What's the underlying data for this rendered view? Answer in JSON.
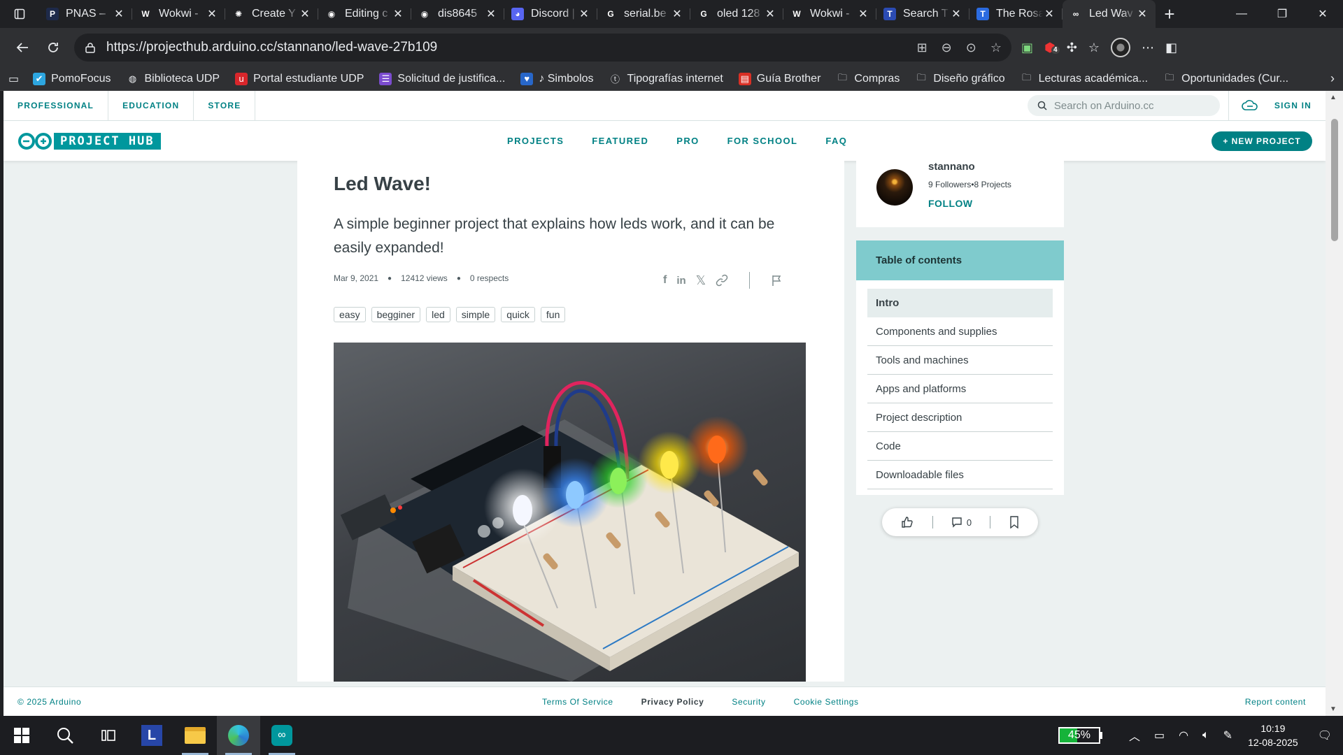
{
  "browser": {
    "tabs": [
      {
        "title": "PNAS – ",
        "fav_color": "#1e2a4a",
        "fav_glyph": "P"
      },
      {
        "title": "Wokwi - ",
        "fav_color": "transparent",
        "fav_glyph": "W"
      },
      {
        "title": "Create Y",
        "fav_color": "transparent",
        "fav_glyph": "✺"
      },
      {
        "title": "Editing c",
        "fav_color": "transparent",
        "fav_glyph": "◉"
      },
      {
        "title": "dis8645",
        "fav_color": "transparent",
        "fav_glyph": "◉"
      },
      {
        "title": "Discord |",
        "fav_color": "#5865f2",
        "fav_glyph": "◕"
      },
      {
        "title": "serial.be",
        "fav_color": "transparent",
        "fav_glyph": "G"
      },
      {
        "title": "oled 128",
        "fav_color": "transparent",
        "fav_glyph": "G"
      },
      {
        "title": "Wokwi - ",
        "fav_color": "transparent",
        "fav_glyph": "W"
      },
      {
        "title": "Search T",
        "fav_color": "#2b4bb3",
        "fav_glyph": "T"
      },
      {
        "title": "The Rosa",
        "fav_color": "#2b6be0",
        "fav_glyph": "T"
      },
      {
        "title": "Led Wav",
        "fav_color": "transparent",
        "fav_glyph": "∞",
        "active": true
      }
    ],
    "url": "https://projecthub.arduino.cc/stannano/led-wave-27b109",
    "extension_badge": "4",
    "bookmarks": [
      {
        "label": "PomoFocus",
        "icon": "check-circle-icon"
      },
      {
        "label": "Biblioteca UDP",
        "icon": "globe-icon"
      },
      {
        "label": "Portal estudiante UDP",
        "icon": "udp-logo-icon"
      },
      {
        "label": "Solicitud de justifica...",
        "icon": "form-icon"
      },
      {
        "label": "♪ Simbolos",
        "icon": "heart-icon"
      },
      {
        "label": "Tipografías internet",
        "icon": "glyph-icon"
      },
      {
        "label": "Guía Brother",
        "icon": "pdf-icon"
      },
      {
        "label": "Compras",
        "icon": "folder-icon"
      },
      {
        "label": "Diseño gráfico",
        "icon": "folder-icon"
      },
      {
        "label": "Lecturas académica...",
        "icon": "folder-icon"
      },
      {
        "label": "Oportunidades (Cur...",
        "icon": "folder-icon"
      }
    ]
  },
  "site": {
    "topnav": {
      "links": [
        "PROFESSIONAL",
        "EDUCATION",
        "STORE"
      ],
      "search_placeholder": "Search on Arduino.cc",
      "sign_in": "SIGN IN"
    },
    "hub": {
      "logo_text": "PROJECT HUB",
      "menu": [
        "PROJECTS",
        "FEATURED",
        "PRO",
        "FOR SCHOOL",
        "FAQ"
      ],
      "new_project": "+ NEW PROJECT"
    },
    "article": {
      "title": "Led Wave!",
      "description": "A simple beginner project that explains how leds work, and it can be easily expanded!",
      "date": "Mar 9, 2021",
      "views": "12412 views",
      "respects": "0 respects",
      "tags": [
        "easy",
        "begginer",
        "led",
        "simple",
        "quick",
        "fun"
      ]
    },
    "author": {
      "name": "stannano",
      "stats": "9 Followers•8 Projects",
      "follow": "FOLLOW"
    },
    "toc": {
      "heading": "Table of contents",
      "items": [
        "Intro",
        "Components and supplies",
        "Tools and machines",
        "Apps and platforms",
        "Project description",
        "Code",
        "Downloadable files"
      ],
      "active_index": 0
    },
    "actions": {
      "comments_count": "0"
    },
    "footer": {
      "copyright": "© 2025 Arduino",
      "links": [
        "Terms Of Service",
        "Privacy Policy",
        "Security",
        "Cookie Settings"
      ],
      "report": "Report content"
    }
  },
  "taskbar": {
    "battery_percent": "45%",
    "battery_level": 0.45,
    "time": "10:19",
    "date": "12-08-2025"
  }
}
